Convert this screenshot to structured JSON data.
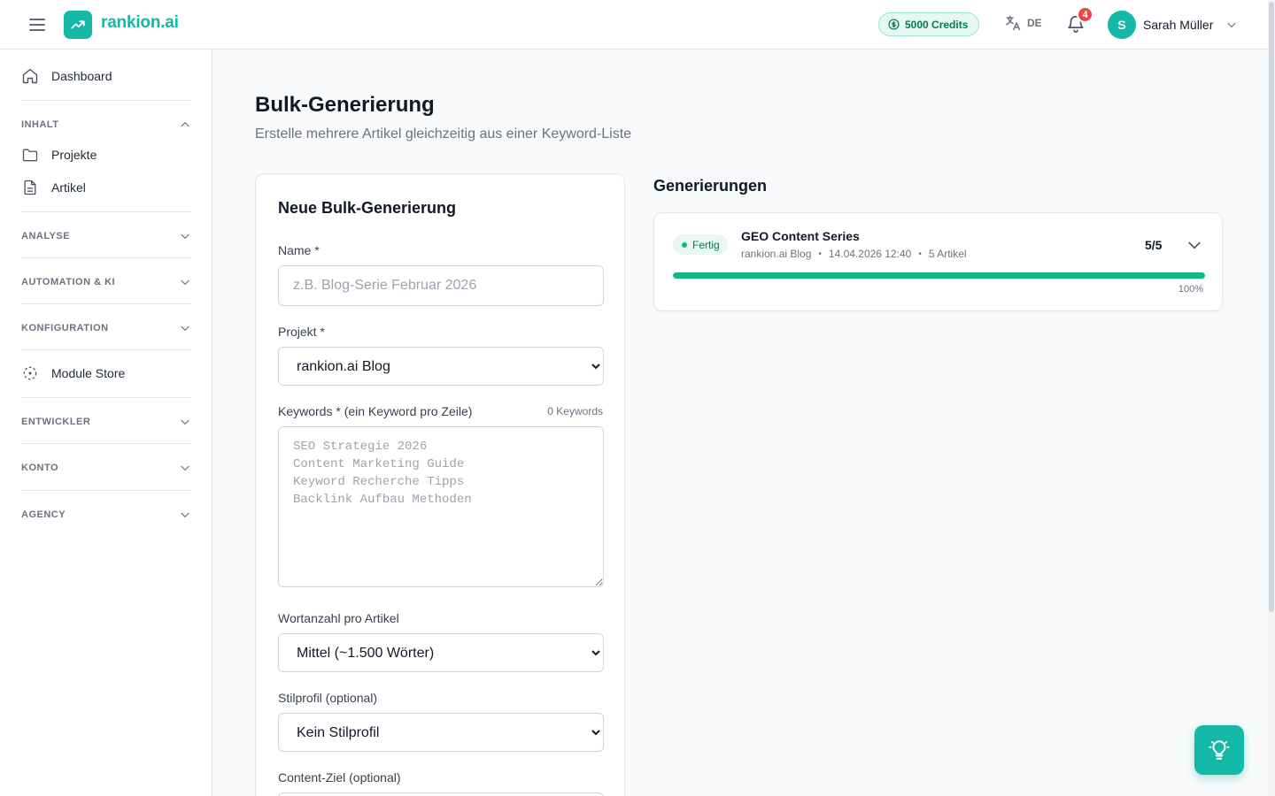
{
  "app": {
    "name": "rankion.ai"
  },
  "header": {
    "credits": "5000 Credits",
    "language": "DE",
    "notifications_count": "4",
    "user_initial": "S",
    "user_name": "Sarah Müller"
  },
  "sidebar": {
    "dashboard": "Dashboard",
    "sections": {
      "inhalt": "INHALT",
      "analyse": "ANALYSE",
      "automation": "AUTOMATION & KI",
      "konfiguration": "KONFIGURATION",
      "entwickler": "ENTWICKLER",
      "konto": "KONTO",
      "agency": "AGENCY"
    },
    "projects": "Projekte",
    "articles": "Artikel",
    "module_store": "Module Store"
  },
  "page": {
    "title": "Bulk-Generierung",
    "subtitle": "Erstelle mehrere Artikel gleichzeitig aus einer Keyword-Liste"
  },
  "form": {
    "title": "Neue Bulk-Generierung",
    "name_label": "Name *",
    "name_placeholder": "z.B. Blog-Serie Februar 2026",
    "project_label": "Projekt *",
    "project_selected": "rankion.ai Blog",
    "keywords_label": "Keywords * (ein Keyword pro Zeile)",
    "keywords_count": "0 Keywords",
    "keywords_placeholder": "SEO Strategie 2026\nContent Marketing Guide\nKeyword Recherche Tipps\nBacklink Aufbau Methoden",
    "wordcount_label": "Wortanzahl pro Artikel",
    "wordcount_selected": "Mittel (~1.500 Wörter)",
    "style_label": "Stilprofil (optional)",
    "style_selected": "Kein Stilprofil",
    "content_goal_label": "Content-Ziel (optional)"
  },
  "generations": {
    "title": "Generierungen",
    "items": [
      {
        "status": "Fertig",
        "name": "GEO Content Series",
        "project": "rankion.ai Blog",
        "date": "14.04.2026 12:40",
        "articles": "5 Artikel",
        "count": "5/5",
        "progress": 1.0,
        "progress_label": "100%"
      }
    ]
  },
  "colors": {
    "brand": "#14b8a6",
    "success": "#10b981",
    "danger": "#ef4444"
  }
}
